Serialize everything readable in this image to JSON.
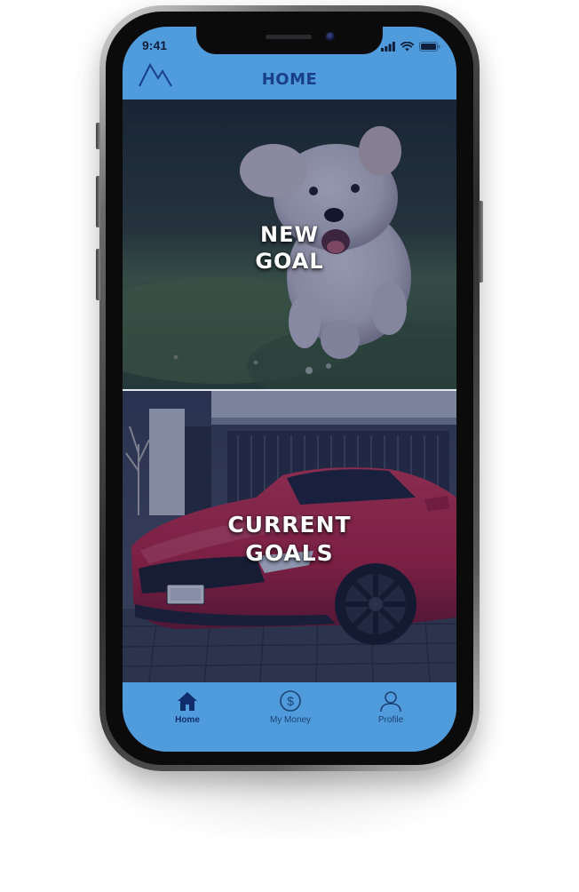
{
  "status_bar": {
    "time": "9:41",
    "signal_icon": "cellular-signal-icon",
    "wifi_icon": "wifi-icon",
    "battery_icon": "battery-icon"
  },
  "header": {
    "title": "HOME",
    "logo_icon": "mountain-logo-icon"
  },
  "tiles": [
    {
      "label_line1": "NEW",
      "label_line2": "GOAL",
      "image": "running-white-dog-photo"
    },
    {
      "label_line1": "CURRENT",
      "label_line2": "GOALS",
      "image": "red-sports-car-photo"
    }
  ],
  "tabbar": {
    "items": [
      {
        "label": "Home",
        "icon": "home-icon",
        "active": true
      },
      {
        "label": "My Money",
        "icon": "dollar-circle-icon",
        "active": false
      },
      {
        "label": "Profile",
        "icon": "user-icon",
        "active": false
      }
    ]
  },
  "colors": {
    "accent": "#4f9bdb",
    "brand_dark": "#1a3f8a",
    "overlay": "#141e50",
    "car_red": "#c4213a"
  }
}
